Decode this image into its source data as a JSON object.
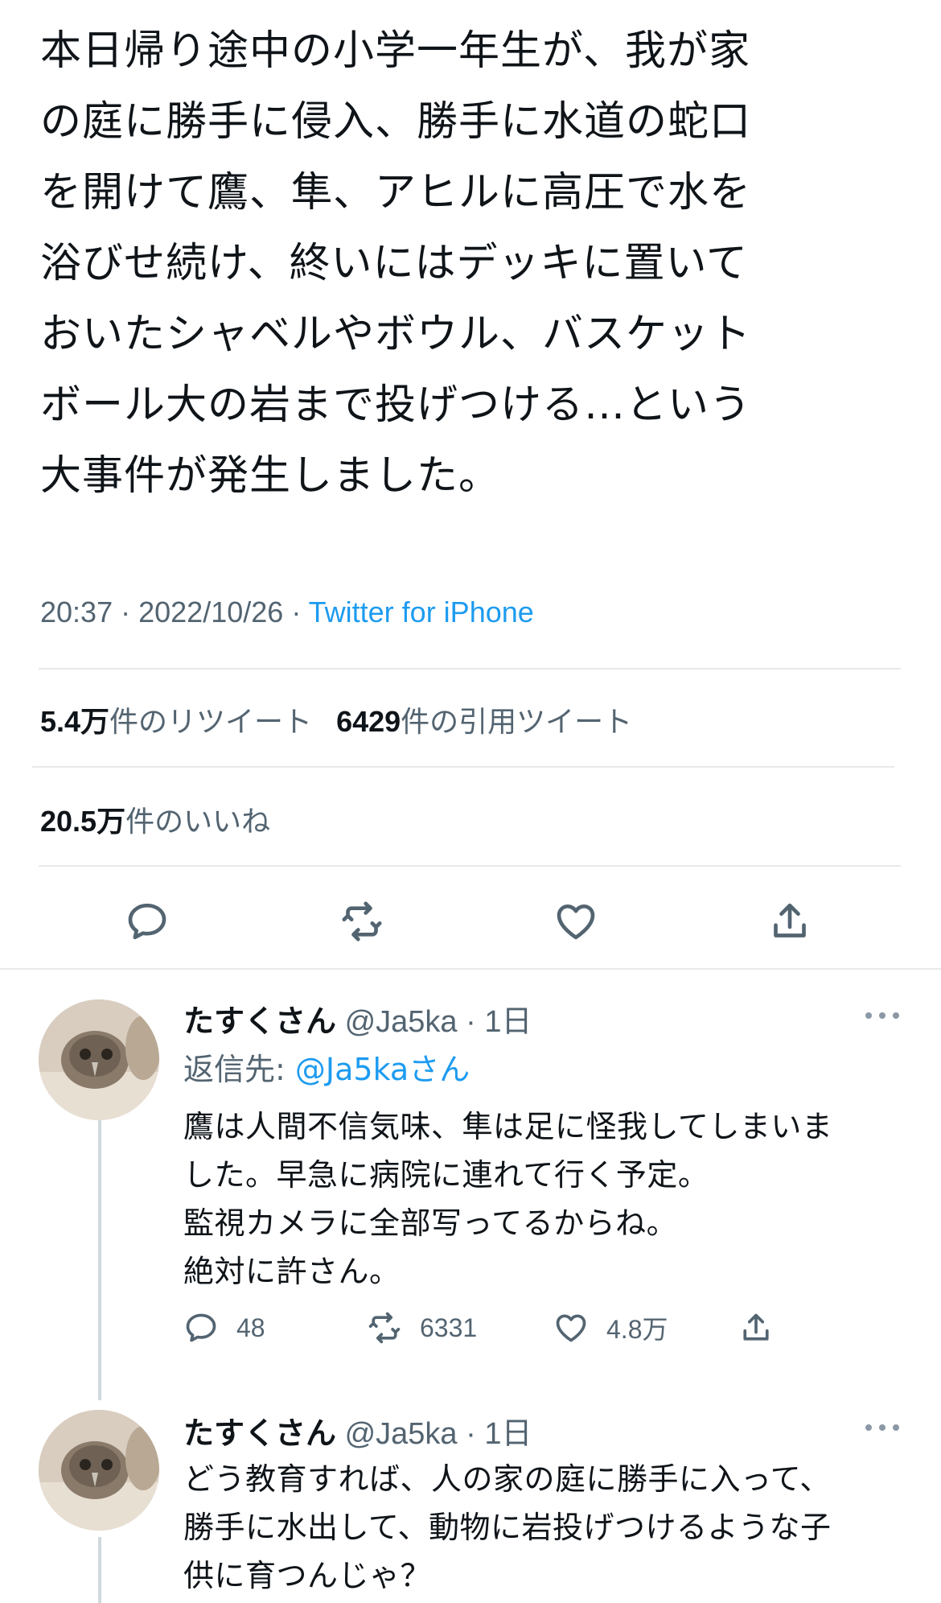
{
  "main_tweet": {
    "text": "本日帰り途中の小学一年生が、我が家\nの庭に勝手に侵入、勝手に水道の蛇口\nを開けて鷹、隼、アヒルに高圧で水を\n浴びせ続け、終いにはデッキに置いて\nおいたシャベルやボウル、バスケット\nボール大の岩まで投げつける…という\n大事件が発生しました。",
    "time": "20:37",
    "date": "2022/10/26",
    "source": "Twitter for iPhone",
    "retweets_count": "5.4万",
    "retweets_label": "件のリツイート",
    "quotes_count": "6429",
    "quotes_label": "件の引用ツイート",
    "likes_count": "20.5万",
    "likes_label": "件のいいね"
  },
  "replies": [
    {
      "name": "たすくさん",
      "handle": "@Ja5ka",
      "age": "1日",
      "reply_to_label": "返信先:",
      "reply_to_handle": "@Ja5ka",
      "reply_to_suffix": "さん",
      "text": "鷹は人間不信気味、隼は足に怪我してしまいま\nした。早急に病院に連れて行く予定。\n監視カメラに全部写ってるからね。\n絶対に許さん。",
      "reply_count": "48",
      "retweet_count": "6331",
      "like_count": "4.8万"
    },
    {
      "name": "たすくさん",
      "handle": "@Ja5ka",
      "age": "1日",
      "text": "どう教育すれば、人の家の庭に勝手に入って、\n勝手に水出して、動物に岩投げつけるような子\n供に育つんじゃ？"
    }
  ],
  "icons": [
    "reply-icon",
    "retweet-icon",
    "like-icon",
    "share-icon",
    "more-icon"
  ],
  "colors": {
    "accent": "#1d9bf0",
    "secondary_text": "#536471",
    "divider": "#e7e9ea"
  }
}
